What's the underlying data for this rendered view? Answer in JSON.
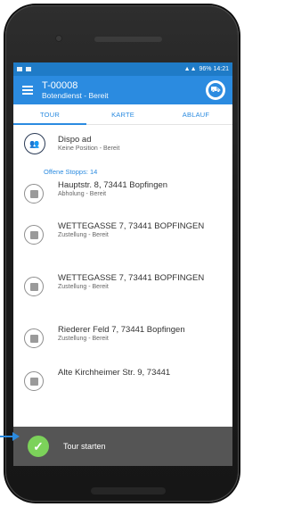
{
  "statusbar": {
    "right_text": "96% 14:21"
  },
  "appbar": {
    "title": "T-00008",
    "subtitle": "Botendienst - Bereit",
    "truck_icon": "truck-icon"
  },
  "tabs": [
    {
      "label": "TOUR"
    },
    {
      "label": "KARTE"
    },
    {
      "label": "ABLAUF"
    }
  ],
  "dispo": {
    "title": "Dispo ad",
    "status": "Keine Position - Bereit"
  },
  "section_title": "Offene Stopps: 14",
  "stops": [
    {
      "address": "Hauptstr. 8, 73441 Bopfingen",
      "meta": "Abholung - Bereit"
    },
    {
      "address": "WETTEGASSE 7, 73441 BOPFINGEN",
      "meta": "Zustellung - Bereit"
    },
    {
      "address": "WETTEGASSE 7, 73441 BOPFINGEN",
      "meta": "Zustellung - Bereit"
    },
    {
      "address": "Riederer Feld 7, 73441 Bopfingen",
      "meta": "Zustellung - Bereit"
    },
    {
      "address": "Alte Kirchheimer Str. 9, 73441",
      "meta": ""
    }
  ],
  "bottom": {
    "label": "Tour starten"
  },
  "colors": {
    "accent": "#2b8be0",
    "bottom_bar": "#555555",
    "check": "#7cd25a"
  }
}
